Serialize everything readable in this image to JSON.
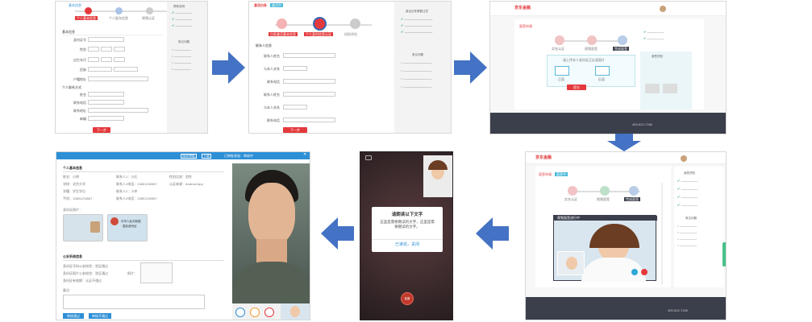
{
  "panel1": {
    "tab_label": "基本信息",
    "step1": "个人基本信息",
    "step2": "个人股东信息",
    "step3": "视频认证",
    "section_basic": "基本信息",
    "section_contact": "个人联系方式",
    "labels": [
      "身份证号",
      "性别",
      "出生年月",
      "民族",
      "户籍地址",
      "姓名",
      "联系电话",
      "联系地址",
      "邮编"
    ],
    "submit": "下一步",
    "sidebar_title": "帮助说明",
    "sidebar_title2": "常见问题"
  },
  "panel2": {
    "title": "激活白条",
    "badge": "激活中",
    "step1": "白条激活基本信息",
    "step2": "个人身份信息认证",
    "step3": "风险评估",
    "section": "联系人信息",
    "labels": [
      "联系人姓名",
      "与本人关系",
      "联系电话",
      "联系人姓名",
      "与本人关系",
      "联系电话"
    ],
    "submit": "下一步",
    "sidebar_title": "激活白条需要注意",
    "sidebar_title2": "常见问题"
  },
  "panel3": {
    "logo": "京东金融",
    "title": "面签申请",
    "step1": "实名认证",
    "step2": "视频面签",
    "step3": "完成面签",
    "hint": "请上传本人身份证正反面照片",
    "upload_front": "正面",
    "upload_back": "反面",
    "submit": "提交",
    "side_title": "面签须知",
    "footer_phone": "400-622-7166"
  },
  "panel4": {
    "logo": "京东金融",
    "title": "面签申请",
    "badge": "面签中",
    "step1": "实名认证",
    "step2": "视频面签",
    "step3": "完成面签",
    "video_title": "视频面签进行中",
    "side_title": "面签须知",
    "side_title2": "常见问题",
    "footer_phone": "400-622-7166"
  },
  "panel5": {
    "dialog_title": "请朗读以下文字",
    "dialog_body": "这里是需要朗读的文字，这里是需要朗读的文字。",
    "dialog_button": "已读完，关闭",
    "hangup": "挂断"
  },
  "panel6": {
    "toolbar": [
      "保存审批",
      "下载",
      "已审批状态：审核中"
    ],
    "section_personal": "个人基本信息",
    "personal_rows": [
      [
        "姓名：小明",
        "联系人1：小红",
        "性别比较：男性"
      ],
      [
        "学校：北京大学",
        "联系人1电话：13801234567",
        "认证来源：Android App"
      ],
      [
        "学籍：学生学位",
        "联系人2：小李",
        ""
      ],
      [
        "手机：13801234567",
        "联系人2电话：13801234567",
        ""
      ]
    ],
    "id_photo_label": "身份证照片：",
    "section_check": "公安系统信息",
    "check_rows": [
      "身份证号码公安校验：验证通过",
      "身份证照片公安校验：验证通过",
      "身份证有效期：认证不通过"
    ],
    "photo_label": "照片：",
    "remark_label": "备注：",
    "approve": "审核通过",
    "reject": "审核不通过",
    "id_card_title": "中华人民共和国",
    "id_card_sub": "居民身份证"
  },
  "colors": {
    "accent_red": "#e4393c",
    "arrow_blue": "#4472c4",
    "header_blue": "#2d8fd6",
    "check_green": "#22a35a",
    "footer_dark": "#3b3f4c"
  }
}
